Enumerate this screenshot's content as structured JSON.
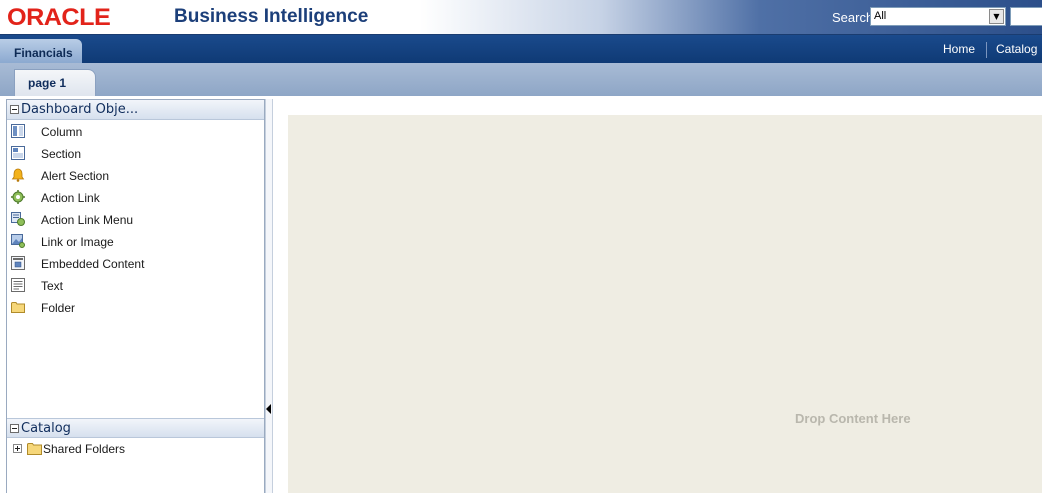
{
  "header": {
    "logo": "ORACLE",
    "product_title": "Business Intelligence",
    "search_label": "Search",
    "search_scope": "All",
    "search_query": ""
  },
  "nav": {
    "active_dashboard": "Financials",
    "links": [
      "Home",
      "Catalog"
    ]
  },
  "page_tabs": [
    "page 1"
  ],
  "dashboard_objects": {
    "title": "Dashboard Obje...",
    "items": [
      {
        "label": "Column",
        "icon": "column-icon"
      },
      {
        "label": "Section",
        "icon": "section-icon"
      },
      {
        "label": "Alert Section",
        "icon": "bell-icon"
      },
      {
        "label": "Action Link",
        "icon": "gear-icon"
      },
      {
        "label": "Action Link Menu",
        "icon": "action-menu-icon"
      },
      {
        "label": "Link or Image",
        "icon": "link-image-icon"
      },
      {
        "label": "Embedded Content",
        "icon": "embedded-content-icon"
      },
      {
        "label": "Text",
        "icon": "text-icon"
      },
      {
        "label": "Folder",
        "icon": "folder-icon"
      }
    ]
  },
  "catalog": {
    "title": "Catalog",
    "items": [
      {
        "label": "Shared Folders",
        "icon": "folder-icon"
      }
    ]
  },
  "canvas": {
    "drop_text": "Drop Content Here"
  },
  "colors": {
    "oracle_red": "#e2231a",
    "nav_blue": "#0f3a75",
    "drop_zone": "#efede3"
  }
}
